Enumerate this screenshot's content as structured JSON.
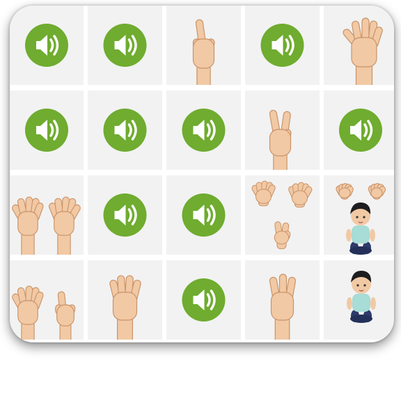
{
  "board": {
    "rows": 4,
    "columns": 5,
    "tiles": [
      {
        "kind": "sound",
        "icon": "speaker-icon"
      },
      {
        "kind": "sound",
        "icon": "speaker-icon"
      },
      {
        "kind": "image",
        "icon": "one-finger-hand-icon"
      },
      {
        "kind": "sound",
        "icon": "speaker-icon"
      },
      {
        "kind": "image",
        "icon": "five-finger-hand-icon"
      },
      {
        "kind": "sound",
        "icon": "speaker-icon"
      },
      {
        "kind": "sound",
        "icon": "speaker-icon"
      },
      {
        "kind": "sound",
        "icon": "speaker-icon"
      },
      {
        "kind": "image",
        "icon": "two-finger-hand-icon"
      },
      {
        "kind": "sound",
        "icon": "speaker-icon"
      },
      {
        "kind": "image",
        "icon": "two-open-hands-icon"
      },
      {
        "kind": "sound",
        "icon": "speaker-icon"
      },
      {
        "kind": "sound",
        "icon": "speaker-icon"
      },
      {
        "kind": "image",
        "icon": "twelve-fingers-hands-icon"
      },
      {
        "kind": "image",
        "icon": "hands-and-child-icon"
      },
      {
        "kind": "image",
        "icon": "five-and-one-hands-icon"
      },
      {
        "kind": "image",
        "icon": "four-finger-hand-icon"
      },
      {
        "kind": "sound",
        "icon": "speaker-icon"
      },
      {
        "kind": "image",
        "icon": "three-finger-hand-icon"
      },
      {
        "kind": "image",
        "icon": "child-figure-icon"
      }
    ]
  },
  "colors": {
    "speaker_green": "#6fac2f",
    "speaker_white": "#ffffff",
    "tile_background": "#f2f2f2",
    "skin": "#f1c9a4",
    "skin_outline": "#c9936a"
  }
}
